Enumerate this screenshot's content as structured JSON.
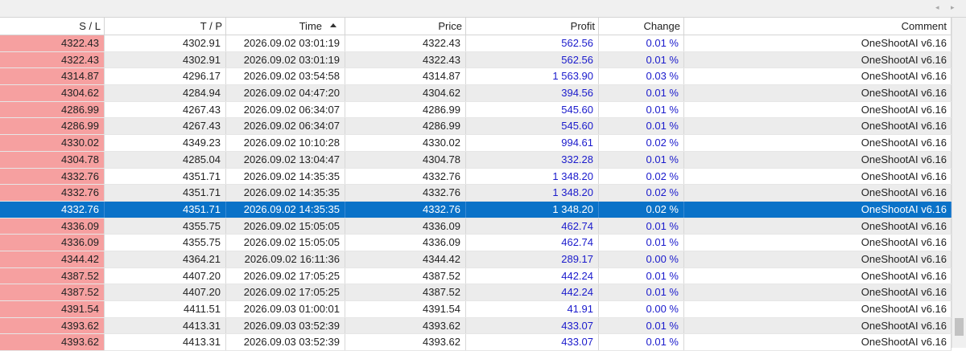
{
  "nav": {
    "left_glyph": "◂",
    "right_glyph": "▸"
  },
  "columns": [
    {
      "key": "sl",
      "label": "S / L"
    },
    {
      "key": "tp",
      "label": "T / P"
    },
    {
      "key": "time",
      "label": "Time"
    },
    {
      "key": "price",
      "label": "Price"
    },
    {
      "key": "profit",
      "label": "Profit"
    },
    {
      "key": "change",
      "label": "Change"
    },
    {
      "key": "comment",
      "label": "Comment"
    }
  ],
  "sort": {
    "column": "time",
    "direction": "ascending"
  },
  "selected_row": 10,
  "colors": {
    "sl_bg": "#f6a0a0",
    "selected_bg": "#0a72c8",
    "profit_text": "#1a1acc",
    "alt_row": "#ececec"
  },
  "rows": [
    {
      "sl": "4322.43",
      "tp": "4302.91",
      "time": "2026.09.02 03:01:19",
      "price": "4322.43",
      "profit": "562.56",
      "change": "0.01 %",
      "comment": "OneShootAI v6.16"
    },
    {
      "sl": "4322.43",
      "tp": "4302.91",
      "time": "2026.09.02 03:01:19",
      "price": "4322.43",
      "profit": "562.56",
      "change": "0.01 %",
      "comment": "OneShootAI v6.16"
    },
    {
      "sl": "4314.87",
      "tp": "4296.17",
      "time": "2026.09.02 03:54:58",
      "price": "4314.87",
      "profit": "1 563.90",
      "change": "0.03 %",
      "comment": "OneShootAI v6.16"
    },
    {
      "sl": "4304.62",
      "tp": "4284.94",
      "time": "2026.09.02 04:47:20",
      "price": "4304.62",
      "profit": "394.56",
      "change": "0.01 %",
      "comment": "OneShootAI v6.16"
    },
    {
      "sl": "4286.99",
      "tp": "4267.43",
      "time": "2026.09.02 06:34:07",
      "price": "4286.99",
      "profit": "545.60",
      "change": "0.01 %",
      "comment": "OneShootAI v6.16"
    },
    {
      "sl": "4286.99",
      "tp": "4267.43",
      "time": "2026.09.02 06:34:07",
      "price": "4286.99",
      "profit": "545.60",
      "change": "0.01 %",
      "comment": "OneShootAI v6.16"
    },
    {
      "sl": "4330.02",
      "tp": "4349.23",
      "time": "2026.09.02 10:10:28",
      "price": "4330.02",
      "profit": "994.61",
      "change": "0.02 %",
      "comment": "OneShootAI v6.16"
    },
    {
      "sl": "4304.78",
      "tp": "4285.04",
      "time": "2026.09.02 13:04:47",
      "price": "4304.78",
      "profit": "332.28",
      "change": "0.01 %",
      "comment": "OneShootAI v6.16"
    },
    {
      "sl": "4332.76",
      "tp": "4351.71",
      "time": "2026.09.02 14:35:35",
      "price": "4332.76",
      "profit": "1 348.20",
      "change": "0.02 %",
      "comment": "OneShootAI v6.16"
    },
    {
      "sl": "4332.76",
      "tp": "4351.71",
      "time": "2026.09.02 14:35:35",
      "price": "4332.76",
      "profit": "1 348.20",
      "change": "0.02 %",
      "comment": "OneShootAI v6.16"
    },
    {
      "sl": "4332.76",
      "tp": "4351.71",
      "time": "2026.09.02 14:35:35",
      "price": "4332.76",
      "profit": "1 348.20",
      "change": "0.02 %",
      "comment": "OneShootAI v6.16"
    },
    {
      "sl": "4336.09",
      "tp": "4355.75",
      "time": "2026.09.02 15:05:05",
      "price": "4336.09",
      "profit": "462.74",
      "change": "0.01 %",
      "comment": "OneShootAI v6.16"
    },
    {
      "sl": "4336.09",
      "tp": "4355.75",
      "time": "2026.09.02 15:05:05",
      "price": "4336.09",
      "profit": "462.74",
      "change": "0.01 %",
      "comment": "OneShootAI v6.16"
    },
    {
      "sl": "4344.42",
      "tp": "4364.21",
      "time": "2026.09.02 16:11:36",
      "price": "4344.42",
      "profit": "289.17",
      "change": "0.00 %",
      "comment": "OneShootAI v6.16"
    },
    {
      "sl": "4387.52",
      "tp": "4407.20",
      "time": "2026.09.02 17:05:25",
      "price": "4387.52",
      "profit": "442.24",
      "change": "0.01 %",
      "comment": "OneShootAI v6.16"
    },
    {
      "sl": "4387.52",
      "tp": "4407.20",
      "time": "2026.09.02 17:05:25",
      "price": "4387.52",
      "profit": "442.24",
      "change": "0.01 %",
      "comment": "OneShootAI v6.16"
    },
    {
      "sl": "4391.54",
      "tp": "4411.51",
      "time": "2026.09.03 01:00:01",
      "price": "4391.54",
      "profit": "41.91",
      "change": "0.00 %",
      "comment": "OneShootAI v6.16"
    },
    {
      "sl": "4393.62",
      "tp": "4413.31",
      "time": "2026.09.03 03:52:39",
      "price": "4393.62",
      "profit": "433.07",
      "change": "0.01 %",
      "comment": "OneShootAI v6.16"
    },
    {
      "sl": "4393.62",
      "tp": "4413.31",
      "time": "2026.09.03 03:52:39",
      "price": "4393.62",
      "profit": "433.07",
      "change": "0.01 %",
      "comment": "OneShootAI v6.16"
    }
  ]
}
